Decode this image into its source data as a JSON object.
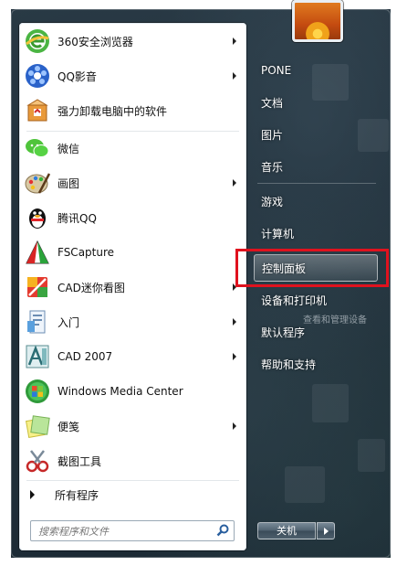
{
  "pinned": [
    {
      "label": "360安全浏览器",
      "icon": "360-browser-icon",
      "has_arrow": true
    },
    {
      "label": "QQ影音",
      "icon": "qq-player-icon",
      "has_arrow": true
    },
    {
      "label": "强力卸载电脑中的软件",
      "icon": "uninstall-box-icon",
      "has_arrow": false
    }
  ],
  "recent": [
    {
      "label": "微信",
      "icon": "wechat-icon",
      "has_arrow": false
    },
    {
      "label": "画图",
      "icon": "paint-icon",
      "has_arrow": true
    },
    {
      "label": "腾讯QQ",
      "icon": "qq-penguin-icon",
      "has_arrow": false
    },
    {
      "label": "FSCapture",
      "icon": "fscapture-icon",
      "has_arrow": false
    },
    {
      "label": "CAD迷你看图",
      "icon": "cad-mini-viewer-icon",
      "has_arrow": true
    },
    {
      "label": "入门",
      "icon": "getting-started-icon",
      "has_arrow": true
    },
    {
      "label": "CAD 2007",
      "icon": "autocad-icon",
      "has_arrow": true
    },
    {
      "label": "Windows Media Center",
      "icon": "media-center-icon",
      "has_arrow": false
    },
    {
      "label": "便笺",
      "icon": "sticky-notes-icon",
      "has_arrow": true
    },
    {
      "label": "截图工具",
      "icon": "snipping-tool-icon",
      "has_arrow": false
    }
  ],
  "all_programs": "所有程序",
  "search": {
    "placeholder": "搜索程序和文件"
  },
  "right": [
    {
      "label": "PONE"
    },
    {
      "label": "文档"
    },
    {
      "label": "图片"
    },
    {
      "label": "音乐"
    },
    {
      "label": "游戏"
    },
    {
      "label": "计算机"
    },
    {
      "label": "控制面板"
    },
    {
      "label": "设备和打印机"
    },
    {
      "label": "默认程序"
    },
    {
      "label": "帮助和支持"
    }
  ],
  "tooltip": "查看和管理设备",
  "shutdown_label": "关机",
  "colors": {
    "highlight_box": "#e0121e",
    "pane_bg": "#ffffff"
  }
}
